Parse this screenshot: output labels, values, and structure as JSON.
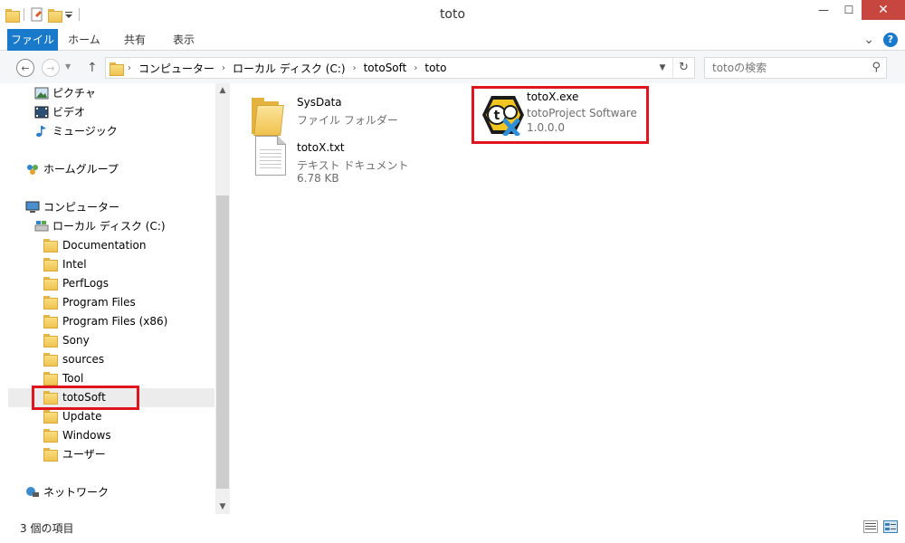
{
  "window": {
    "title": "toto",
    "minimize_glyph": "—",
    "maximize_glyph": "☐",
    "close_glyph": "✕"
  },
  "ribbon": {
    "tabs": [
      "ファイル",
      "ホーム",
      "共有",
      "表示"
    ],
    "collapse_glyph": "⌄",
    "help_glyph": "?"
  },
  "address": {
    "back_glyph": "←",
    "forward_glyph": "→",
    "up_glyph": "↑",
    "breadcrumbs": [
      "コンピューター",
      "ローカル ディスク (C:)",
      "totoSoft",
      "toto"
    ],
    "chevron_glyph": "›",
    "dropdown_glyph": "▼",
    "refresh_glyph": "↻"
  },
  "search": {
    "placeholder": "totoの検索",
    "icon": "search-icon",
    "glyph": "⚲"
  },
  "nav": {
    "libraries": [
      {
        "label": "ピクチャ",
        "icon": "pictures-icon"
      },
      {
        "label": "ビデオ",
        "icon": "videos-icon"
      },
      {
        "label": "ミュージック",
        "icon": "music-icon"
      }
    ],
    "homegroup": {
      "label": "ホームグループ",
      "icon": "homegroup-icon"
    },
    "computer": {
      "label": "コンピューター",
      "icon": "computer-icon"
    },
    "drive": {
      "label": "ローカル ディスク (C:)",
      "icon": "drive-icon"
    },
    "folders": [
      {
        "label": "Documentation"
      },
      {
        "label": "Intel"
      },
      {
        "label": "PerfLogs"
      },
      {
        "label": "Program Files"
      },
      {
        "label": "Program Files (x86)"
      },
      {
        "label": "Sony"
      },
      {
        "label": "sources"
      },
      {
        "label": "Tool"
      },
      {
        "label": "totoSoft",
        "selected": true
      },
      {
        "label": "Update"
      },
      {
        "label": "Windows"
      },
      {
        "label": "ユーザー"
      }
    ],
    "network": {
      "label": "ネットワーク",
      "icon": "network-icon"
    }
  },
  "files": [
    {
      "name": "SysData",
      "type": "ファイル フォルダー",
      "icon": "folder-icon"
    },
    {
      "name": "totoX.txt",
      "type": "テキスト ドキュメント",
      "size": "6.78 KB",
      "icon": "text-document-icon"
    },
    {
      "name": "totoX.exe",
      "type": "totoProject Software",
      "size": "1.0.0.0",
      "icon": "totox-app-icon"
    }
  ],
  "status": {
    "item_count": "3 個の項目"
  },
  "colors": {
    "accent": "#1979ca",
    "highlight": "#e0141c",
    "close": "#c7463f"
  }
}
